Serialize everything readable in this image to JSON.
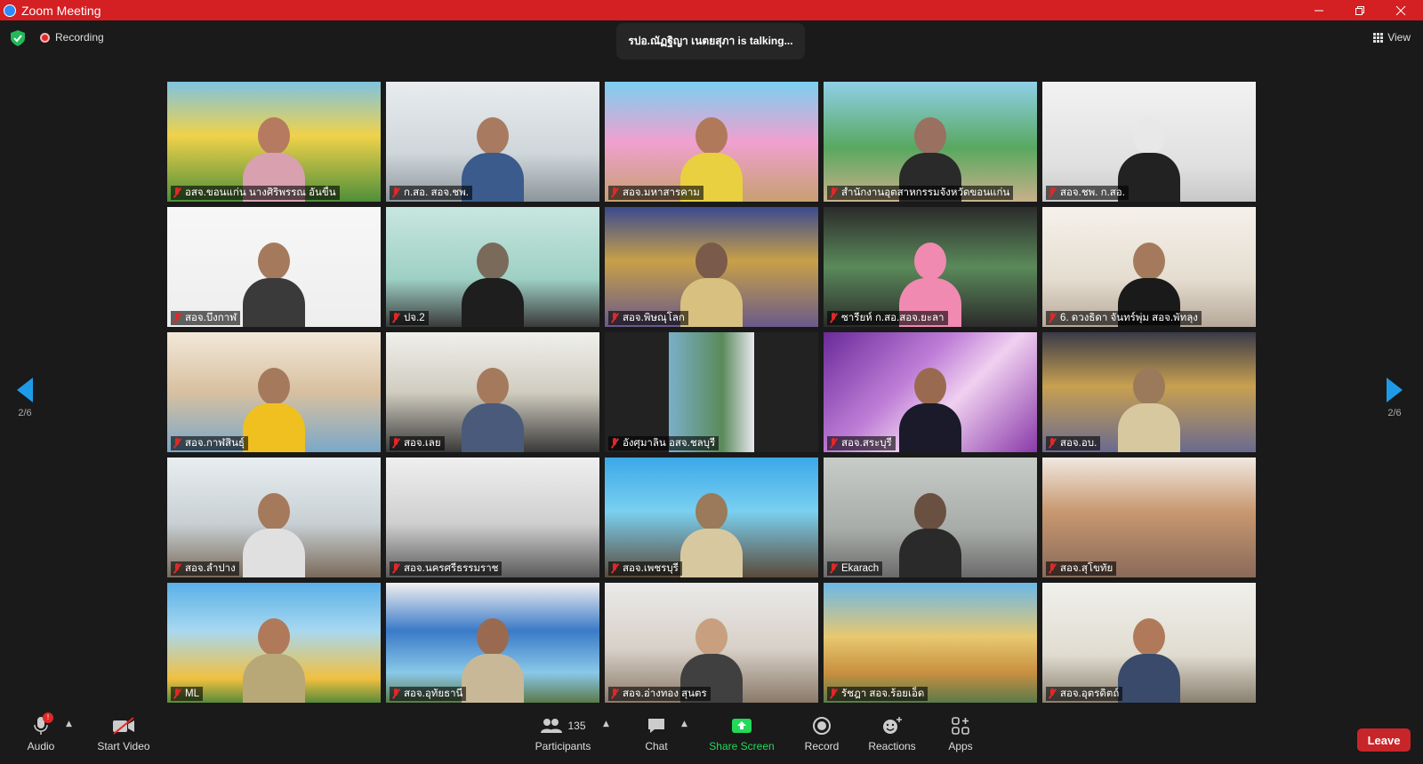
{
  "window": {
    "title": "Zoom Meeting",
    "minimize_icon": "minimize-icon",
    "maximize_icon": "restore-icon",
    "close_icon": "close-icon"
  },
  "topbar": {
    "recording_label": "Recording",
    "talking_text": "รปอ.ณัฏฐิญา เนตยสุภา is  talking...",
    "view_label": "View"
  },
  "pager": {
    "left_label": "2/6",
    "right_label": "2/6"
  },
  "tiles": [
    {
      "name": "อสจ.ขอนแก่น นางศิริพรรณ อันขื่น",
      "scene": "banner-yellow"
    },
    {
      "name": "ก.สอ. สอจ.ชพ.",
      "scene": "office-white"
    },
    {
      "name": "สอจ.มหาสารคาม",
      "scene": "banner-temple"
    },
    {
      "name": "สำนักงานอุตสาหกรรมจังหวัดขอนแก่น",
      "scene": "banner-green"
    },
    {
      "name": "สอจ.ชพ. ก.สอ.",
      "scene": "woman-mask"
    },
    {
      "name": "สอจ.บึงกาฬ",
      "scene": "man-white"
    },
    {
      "name": "ปจ.2",
      "scene": "chair"
    },
    {
      "name": "สอจ.พิษณุโลก",
      "scene": "buddha"
    },
    {
      "name": "ซารียห์ ก.สอ.สอจ.ยะลา",
      "scene": "pink-hijab"
    },
    {
      "name": "6. ดวงธิดา จันทร์พุ่ม สอจ.พัทลุง",
      "scene": "office-woman"
    },
    {
      "name": "สอจ.กาฬสินธุ์",
      "scene": "meeting-yellow"
    },
    {
      "name": "สอจ.เลย",
      "scene": "meeting-room"
    },
    {
      "name": "อังศุมาลิน อสจ.ชลบุรี",
      "scene": "mountain-poster"
    },
    {
      "name": "สอจ.สระบุรี",
      "scene": "purple-bg"
    },
    {
      "name": "สอจ.อบ.",
      "scene": "conference-hall"
    },
    {
      "name": "สอจ.ลำปาง",
      "scene": "office-two"
    },
    {
      "name": "สอจ.นครศรีธรรมราช",
      "scene": "empty-office"
    },
    {
      "name": "สอจ.เพชรบุรี",
      "scene": "blue-banner"
    },
    {
      "name": "Ekarach",
      "scene": "dark-man"
    },
    {
      "name": "สอจ.สุโขทัย",
      "scene": "ruins"
    },
    {
      "name": "ML",
      "scene": "monument"
    },
    {
      "name": "สอจ.อุทัยธานี",
      "scene": "river-banner"
    },
    {
      "name": "สอจ.อ่างทอง สุนตร",
      "scene": "office-mask"
    },
    {
      "name": "รัชฎา สอจ.ร้อยเอ็ด",
      "scene": "golden-tower"
    },
    {
      "name": "สอจ.อุตรดิตถ์",
      "scene": "office-people"
    }
  ],
  "toolbar": {
    "audio_label": "Audio",
    "audio_badge": "!",
    "video_label": "Start Video",
    "participants_count": "135",
    "participants_label": "Participants",
    "chat_label": "Chat",
    "share_label": "Share Screen",
    "record_label": "Record",
    "reactions_label": "Reactions",
    "apps_label": "Apps",
    "leave_label": "Leave"
  },
  "colors": {
    "titlebar": "#d41f23",
    "share_green": "#23d959",
    "leave_red": "#c8252a",
    "accent_blue": "#1e9be8"
  }
}
